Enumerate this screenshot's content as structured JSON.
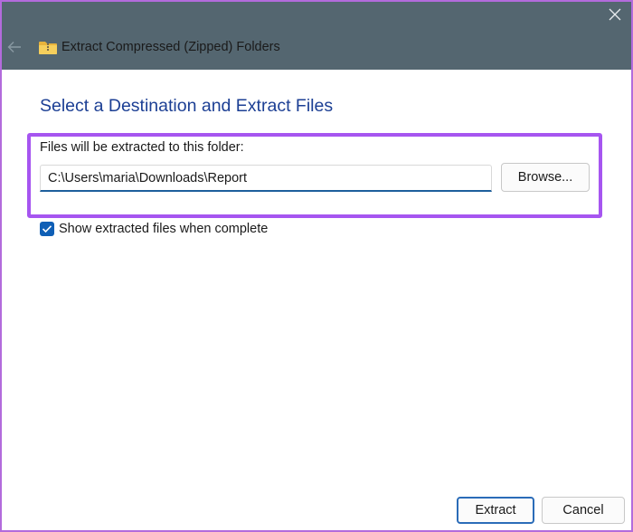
{
  "window": {
    "title": "Extract Compressed (Zipped) Folders",
    "title_bar_color": "#546670",
    "highlight_color": "#a655f0"
  },
  "icons": {
    "close": "close-icon",
    "back": "back-arrow-icon",
    "folder": "zip-folder-icon",
    "checkmark": "checkmark-icon"
  },
  "main": {
    "heading": "Select a Destination and Extract Files",
    "folder_label": "Files will be extracted to this folder:",
    "path_value": "C:\\Users\\maria\\Downloads\\Report",
    "browse_label": "Browse...",
    "show_files_label": "Show extracted files when complete",
    "show_files_checked": true
  },
  "footer": {
    "extract_label": "Extract",
    "cancel_label": "Cancel"
  }
}
